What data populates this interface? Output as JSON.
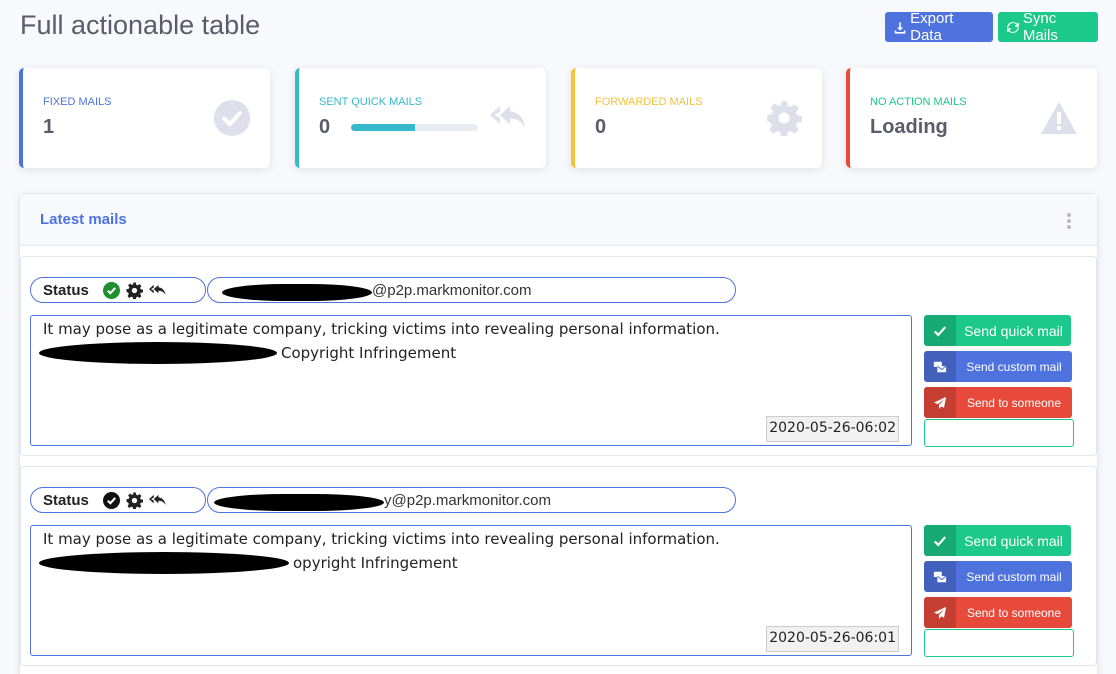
{
  "header": {
    "title": "Full actionable table",
    "export_label": "Export Data",
    "sync_label": "Sync Mails"
  },
  "stats": [
    {
      "label": "FIXED MAILS",
      "value": "1",
      "icon": "check-circle-icon",
      "color": "#4e73df"
    },
    {
      "label": "SENT QUICK MAILS",
      "value": "0",
      "progress": 0.5,
      "icon": "reply-all-icon",
      "color": "#36b9cc"
    },
    {
      "label": "FORWARDED MAILS",
      "value": "0",
      "icon": "gear-icon",
      "color": "#f6c23e"
    },
    {
      "label": "NO ACTION MAILS",
      "value": "Loading",
      "icon": "warning-icon",
      "color": "#e74a3b"
    }
  ],
  "panel": {
    "title": "Latest mails"
  },
  "mails": [
    {
      "status_label": "Status",
      "email_domain": "@p2p.markmonitor.com",
      "line1": "It may pose as a legitimate company, tricking victims into revealing personal information.",
      "line2_suffix": "Copyright Infringement",
      "date": "2020-05-26-06:02",
      "check_color": "#1e8e2e"
    },
    {
      "status_label": "Status",
      "email_domain": "y@p2p.markmonitor.com",
      "line1": "It may pose as a legitimate company, tricking victims into revealing personal information.",
      "line2_suffix": "opyright Infringement",
      "date": "2020-05-26-06:01",
      "check_color": "#111111"
    }
  ],
  "actions": {
    "quick": "Send quick mail",
    "custom": "Send custom mail",
    "someone": "Send to someone"
  },
  "colors": {
    "primary": "#4e73df",
    "success": "#1cc88a",
    "info": "#36b9cc",
    "warning": "#f6c23e",
    "danger": "#e74a3b"
  }
}
